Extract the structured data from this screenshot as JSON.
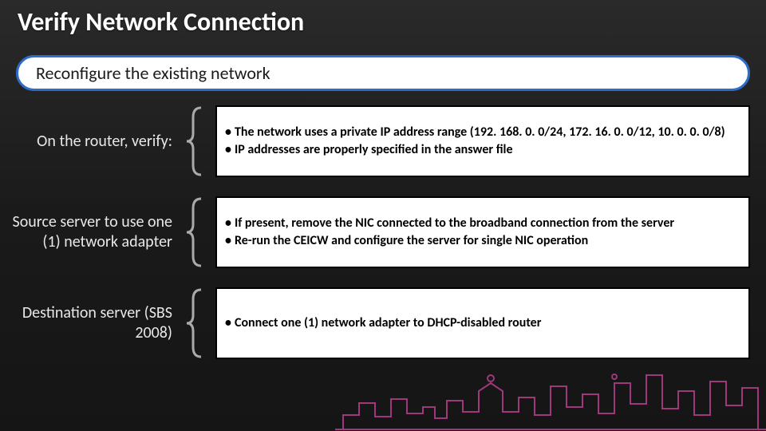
{
  "title": "Verify Network Connection",
  "header": "Reconfigure the existing network",
  "rows": [
    {
      "label": "On the router, verify:",
      "bullets": [
        "The network uses a private IP address range (192. 168. 0. 0/24, 172. 16. 0. 0/12, 10. 0. 0. 0/8)",
        "IP addresses are properly specified in the answer file"
      ]
    },
    {
      "label": "Source server to use one (1) network adapter",
      "bullets": [
        "If present, remove the NIC connected to the broadband connection from the server",
        "Re-run the CEICW and configure the server for single NIC operation"
      ]
    },
    {
      "label": "Destination server (SBS 2008)",
      "bullets": [
        "Connect one (1) network adapter to DHCP-disabled router"
      ]
    }
  ],
  "colors": {
    "header_border": "#2e6cc7",
    "skyline": "#b83f8c"
  }
}
